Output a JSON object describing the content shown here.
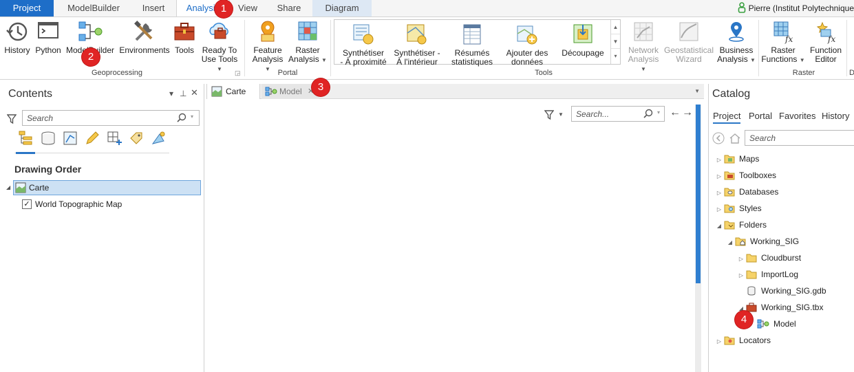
{
  "tabs": {
    "project": "Project",
    "modelbuilder": "ModelBuilder",
    "insert": "Insert",
    "analysis": "Analysis",
    "view": "View",
    "share": "Share",
    "diagram": "Diagram"
  },
  "user": {
    "name": "Pierre (Institut Polytechnique"
  },
  "ribbon": {
    "geoprocessing": {
      "label": "Geoprocessing",
      "history": "History",
      "python": "Python",
      "modelbuilder": "ModelBuilder",
      "environments": "Environments",
      "tools": "Tools",
      "ready_line1": "Ready To",
      "ready_line2": "Use Tools"
    },
    "portal": {
      "label": "Portal",
      "feature_line1": "Feature",
      "feature_line2": "Analysis",
      "raster_line1": "Raster",
      "raster_line2": "Analysis"
    },
    "tools": {
      "label": "Tools",
      "items": [
        {
          "line1": "Synthétiser",
          "line2": "- À proximité"
        },
        {
          "line1": "Synthétiser -",
          "line2": "À l'intérieur"
        },
        {
          "line1": "Résumés",
          "line2": "statistiques"
        },
        {
          "line1": "Ajouter des",
          "line2": "données"
        },
        {
          "line1": "Découpage",
          "line2": ""
        }
      ],
      "network_line1": "Network",
      "network_line2": "Analysis",
      "geostat_line1": "Geostatistical",
      "geostat_line2": "Wizard",
      "business_line1": "Business",
      "business_line2": "Analysis"
    },
    "raster": {
      "label": "Raster",
      "functions_line1": "Raster",
      "functions_line2": "Functions",
      "editor_line1": "Function",
      "editor_line2": "Editor"
    },
    "partial_label": "D"
  },
  "contents": {
    "title": "Contents",
    "search_placeholder": "Search",
    "section": "Drawing Order",
    "map_name": "Carte",
    "layer_name": "World Topographic Map",
    "layer_checked": true
  },
  "view_tabs": {
    "map": "Carte",
    "model": "Model",
    "search_placeholder": "Search..."
  },
  "catalog": {
    "title": "Catalog",
    "tabs": [
      "Project",
      "Portal",
      "Favorites",
      "History"
    ],
    "search_placeholder": "Search",
    "items": {
      "maps": "Maps",
      "toolboxes": "Toolboxes",
      "databases": "Databases",
      "styles": "Styles",
      "folders": "Folders",
      "working_sig": "Working_SIG",
      "cloudburst": "Cloudburst",
      "importlog": "ImportLog",
      "gdb": "Working_SIG.gdb",
      "tbx": "Working_SIG.tbx",
      "model": "Model",
      "locators": "Locators"
    }
  },
  "callouts": [
    "1",
    "2",
    "3",
    "4"
  ],
  "colors": {
    "accent": "#1e6ec8",
    "badge": "#e02424",
    "selection": "#cde1f4"
  }
}
